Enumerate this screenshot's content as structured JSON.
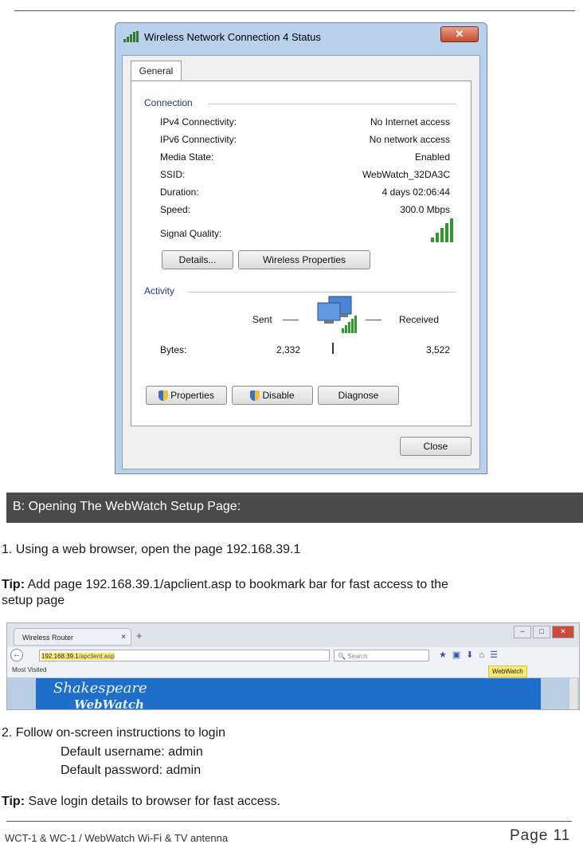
{
  "dialog": {
    "title": "Wireless Network Connection 4 Status",
    "close_glyph": "✕",
    "tab": "General",
    "connection_label": "Connection",
    "rows": [
      {
        "label": "IPv4 Connectivity:",
        "value": "No Internet access"
      },
      {
        "label": "IPv6 Connectivity:",
        "value": "No network access"
      },
      {
        "label": "Media State:",
        "value": "Enabled"
      },
      {
        "label": "SSID:",
        "value": "WebWatch_32DA3C"
      },
      {
        "label": "Duration:",
        "value": "4 days 02:06:44"
      },
      {
        "label": "Speed:",
        "value": "300.0 Mbps"
      }
    ],
    "signal_label": "Signal Quality:",
    "details_button": "Details...",
    "wireless_props_button": "Wireless Properties",
    "activity_label": "Activity",
    "sent_label": "Sent",
    "received_label": "Received",
    "bytes_label": "Bytes:",
    "bytes_sent": "2,332",
    "bytes_received": "3,522",
    "properties_button": "Properties",
    "disable_button": "Disable",
    "diagnose_button": "Diagnose",
    "close_button": "Close"
  },
  "section_header": "B: Opening The WebWatch Setup Page:",
  "step1": "1. Using a web browser, open the page 192.168.39.1",
  "tip1_label": "Tip:",
  "tip1_line1": " Add page 192.168.39.1/apclient.asp to bookmark bar for fast access to the",
  "tip1_line2": "setup page",
  "browser": {
    "tab_title": "Wireless Router",
    "tab_close": "×",
    "new_tab": "+",
    "url_host": "192.168.39.1",
    "url_path": "/apclient.asp",
    "search_placeholder": "Search",
    "most_visited": "Most Visited",
    "bookmark": "WebWatch",
    "logo_line1": "Shakespeare",
    "logo_line2": "WebWatch"
  },
  "step2": "2. Follow on-screen instructions to login",
  "username_line": "Default username: admin",
  "password_line": "Default password: admin",
  "tip2_label": "Tip:",
  "tip2_text": " Save login details to browser for fast access.",
  "footer": {
    "left": "WCT-1 & WC-1 / WebWatch Wi-Fi & TV antenna",
    "right": "Page  11"
  }
}
